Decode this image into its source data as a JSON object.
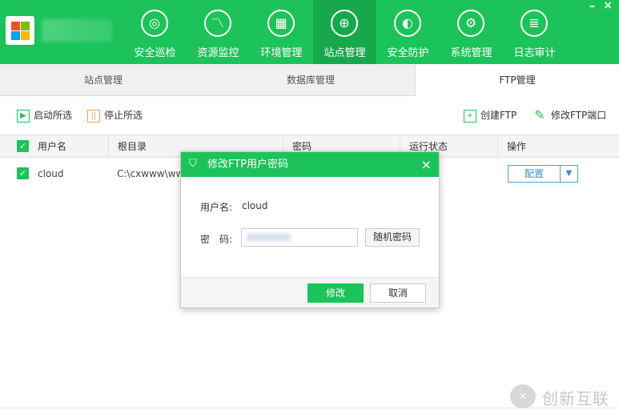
{
  "window": {
    "minimize": "–",
    "close": "×"
  },
  "nav": [
    {
      "label": "安全巡检",
      "icon": "radar-icon",
      "glyph": "◎"
    },
    {
      "label": "资源监控",
      "icon": "chart-monitor-icon",
      "glyph": "〽"
    },
    {
      "label": "环境管理",
      "icon": "building-icon",
      "glyph": "▦"
    },
    {
      "label": "站点管理",
      "icon": "globe-icon",
      "glyph": "⊕"
    },
    {
      "label": "安全防护",
      "icon": "shield-icon",
      "glyph": "◐"
    },
    {
      "label": "系统管理",
      "icon": "settings-icon",
      "glyph": "⚙"
    },
    {
      "label": "日志审计",
      "icon": "document-icon",
      "glyph": "≣"
    }
  ],
  "tabs": [
    "站点管理",
    "数据库管理",
    "FTP管理"
  ],
  "toolbar": {
    "start_selected": "启动所选",
    "stop_selected": "停止所选",
    "create_ftp": "创建FTP",
    "modify_port": "修改FTP端口"
  },
  "table": {
    "headers": [
      "用户名",
      "根目录",
      "密码",
      "运行状态",
      "操作"
    ],
    "rows": [
      {
        "username": "cloud",
        "root": "C:\\cxwww\\www",
        "action": "配置"
      }
    ]
  },
  "dialog": {
    "title": "修改FTP用户密码",
    "close": "×",
    "username_label": "用户名:",
    "username_value": "cloud",
    "password_label": "密　码:",
    "random_button": "随机密码",
    "ok_button": "修改",
    "cancel_button": "取消"
  },
  "watermark": {
    "logo": "✕",
    "text": "创新互联"
  },
  "colors": {
    "accent": "#1cc35a",
    "accent_dark": "#17a84c",
    "link_blue": "#3b8ed0",
    "warning": "#f5a04c"
  }
}
